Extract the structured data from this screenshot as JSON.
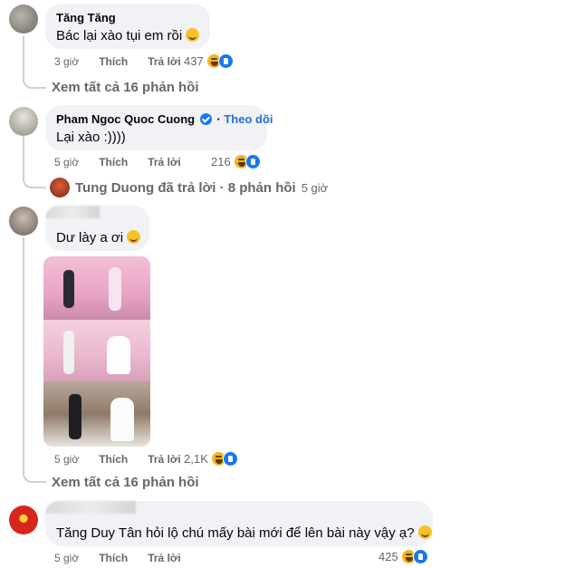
{
  "comments": [
    {
      "author": "Tăng Tăng",
      "text": "Bác lại xào tụi em rồi",
      "time": "3 giờ",
      "like": "Thích",
      "reply": "Trả lời",
      "reactions": "437"
    },
    {
      "author": "Pham Ngoc Quoc Cuong",
      "follow": "Theo dõi",
      "text": "Lại xào :))))",
      "time": "5 giờ",
      "like": "Thích",
      "reply": "Trả lời",
      "reactions": "216"
    },
    {
      "author": "",
      "text": "Dư lày a ơi",
      "time": "5 giờ",
      "like": "Thích",
      "reply": "Trả lời",
      "reactions": "2,1K"
    },
    {
      "author": "",
      "text": "Tăng Duy Tân hỏi lộ chú mấy bài mới để lên bài này vậy ạ?",
      "time": "5 giờ",
      "like": "Thích",
      "reply": "Trả lời",
      "reactions": "425"
    }
  ],
  "see_more_1": "Xem tất cả 16 phản hồi",
  "see_more_2": "Xem tất cả 16 phản hồi",
  "reply_summary": {
    "who": "Tung Duong đã trả lời · 8 phản hồi",
    "time": "5 giờ"
  },
  "colors": {
    "bubble": "#f0f2f5",
    "meta": "#65676b",
    "follow": "#216fdb",
    "like_blue": "#1877f2",
    "haha_yellow": "#f7b125"
  },
  "icons": [
    "haha-reaction-icon",
    "like-reaction-icon",
    "verified-badge-icon",
    "smile-emoji-icon"
  ]
}
